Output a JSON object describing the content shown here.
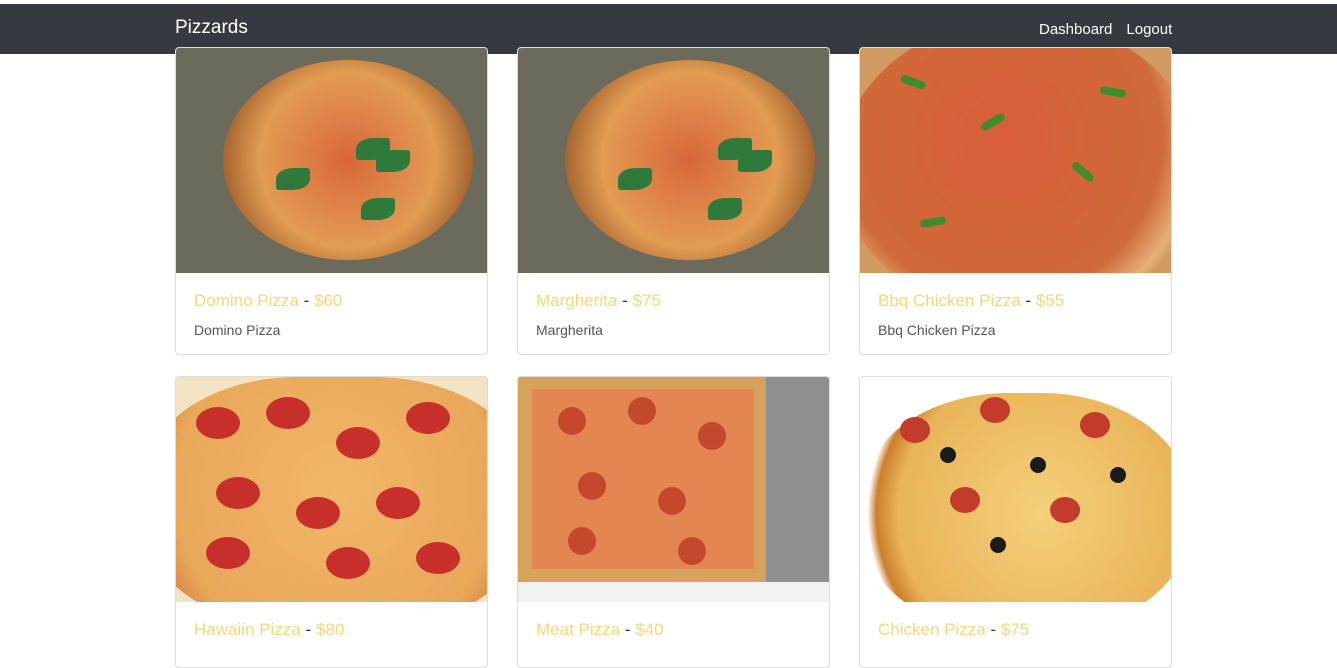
{
  "nav": {
    "brand": "Pizzards",
    "links": [
      "Dashboard",
      "Logout"
    ]
  },
  "cards": [
    {
      "name": "Domino Pizza",
      "price": "$60",
      "description": "Domino Pizza",
      "image": "margherita-pizza-image"
    },
    {
      "name": "Margherita",
      "price": "$75",
      "description": "Margherita",
      "image": "margherita-pizza-image"
    },
    {
      "name": "Bbq Chicken Pizza",
      "price": "$55",
      "description": "Bbq Chicken Pizza",
      "image": "bbq-chicken-pizza-image"
    },
    {
      "name": "Hawaiin Pizza",
      "price": "$80",
      "description": "",
      "image": "pepperoni-pizza-image"
    },
    {
      "name": "Meat Pizza",
      "price": "$40",
      "description": "",
      "image": "meat-pizza-image"
    },
    {
      "name": "Chicken Pizza",
      "price": "$75",
      "description": "",
      "image": "chicken-pizza-image"
    }
  ],
  "separator": "-",
  "colors": {
    "navbar": "#343a40",
    "title_accent": "#f5d77a"
  }
}
